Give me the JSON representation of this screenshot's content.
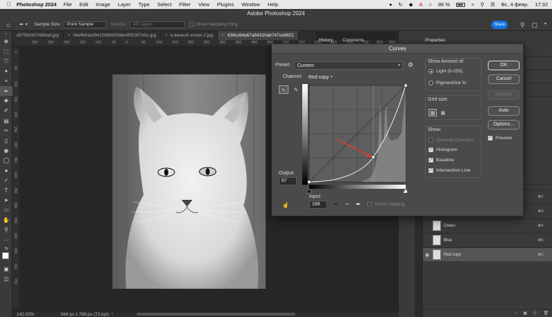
{
  "menubar": {
    "app": "Photoshop 2024",
    "items": [
      "File",
      "Edit",
      "Image",
      "Layer",
      "Type",
      "Select",
      "Filter",
      "View",
      "Plugins",
      "Window",
      "Help"
    ],
    "battery": "86 %",
    "date": "Вс, 4 февр.",
    "time": "17:32"
  },
  "window_title": "Adobe Photoshop 2024",
  "options": {
    "sample_size_label": "Sample Size:",
    "sample_size_value": "Point Sample",
    "sample_label": "Sample:",
    "sample_value": "All Layers",
    "show_ring": "Show Sampling Ring",
    "share": "Share"
  },
  "tabs": [
    {
      "label": "d575b2837689ad.jpg",
      "active": false
    },
    {
      "label": "0bef643a394109bfd25dbe4f05307e5c.jpg",
      "active": false
    },
    {
      "label": "в ванной копия 2.jpg",
      "active": false
    },
    {
      "label": "439cc64a67a64310ab747ce8821",
      "active": true
    }
  ],
  "ruler_top": [
    "300",
    "250",
    "200",
    "150",
    "100",
    "50",
    "0",
    "50",
    "100",
    "150",
    "200",
    "250",
    "300",
    "350",
    "400",
    "450",
    "500",
    "550",
    "600",
    "650",
    "700",
    "750",
    "800",
    "850",
    "900"
  ],
  "ruler_left": [
    "0",
    "50",
    "100",
    "150",
    "200",
    "250",
    "300",
    "350",
    "400",
    "450",
    "500",
    "550",
    "600",
    "650",
    "700",
    "750"
  ],
  "status": {
    "zoom": "142.02%",
    "dims": "564 px x 789 px (72 ppi)"
  },
  "panels": {
    "history": "History",
    "comments": "Comments",
    "properties": "Properties"
  },
  "layers": [
    {
      "name": "",
      "key": "⌘2"
    },
    {
      "name": "",
      "key": "⌘3"
    },
    {
      "name": "Green",
      "key": "⌘4"
    },
    {
      "name": "Blue",
      "key": "⌘5"
    },
    {
      "name": "Red copy",
      "key": "⌘6",
      "selected": true
    }
  ],
  "curves": {
    "title": "Curves",
    "preset_label": "Preset:",
    "preset_value": "Custom",
    "channel_label": "Channel:",
    "channel_value": "Red copy",
    "output_label": "Output:",
    "output_value": "67",
    "input_label": "Input:",
    "input_value": "169",
    "show_clipping": "Show Clipping",
    "show_amount_title": "Show Amount of:",
    "light_label": "Light  (0-255)",
    "pigment_label": "Pigment/Ink %",
    "grid_size_title": "Grid size:",
    "show_title": "Show:",
    "channel_overlays": "Channel Overlays",
    "histogram": "Histogram",
    "baseline": "Baseline",
    "intersection": "Intersection Line",
    "buttons": {
      "ok": "OK",
      "cancel": "Cancel",
      "smooth": "Smooth",
      "auto": "Auto",
      "options": "Options...",
      "preview": "Preview"
    }
  },
  "colors": {
    "accent": "#1473e6",
    "panel": "#3a3a3a",
    "dialog": "#4a4a4a",
    "arrow": "#e53935"
  }
}
